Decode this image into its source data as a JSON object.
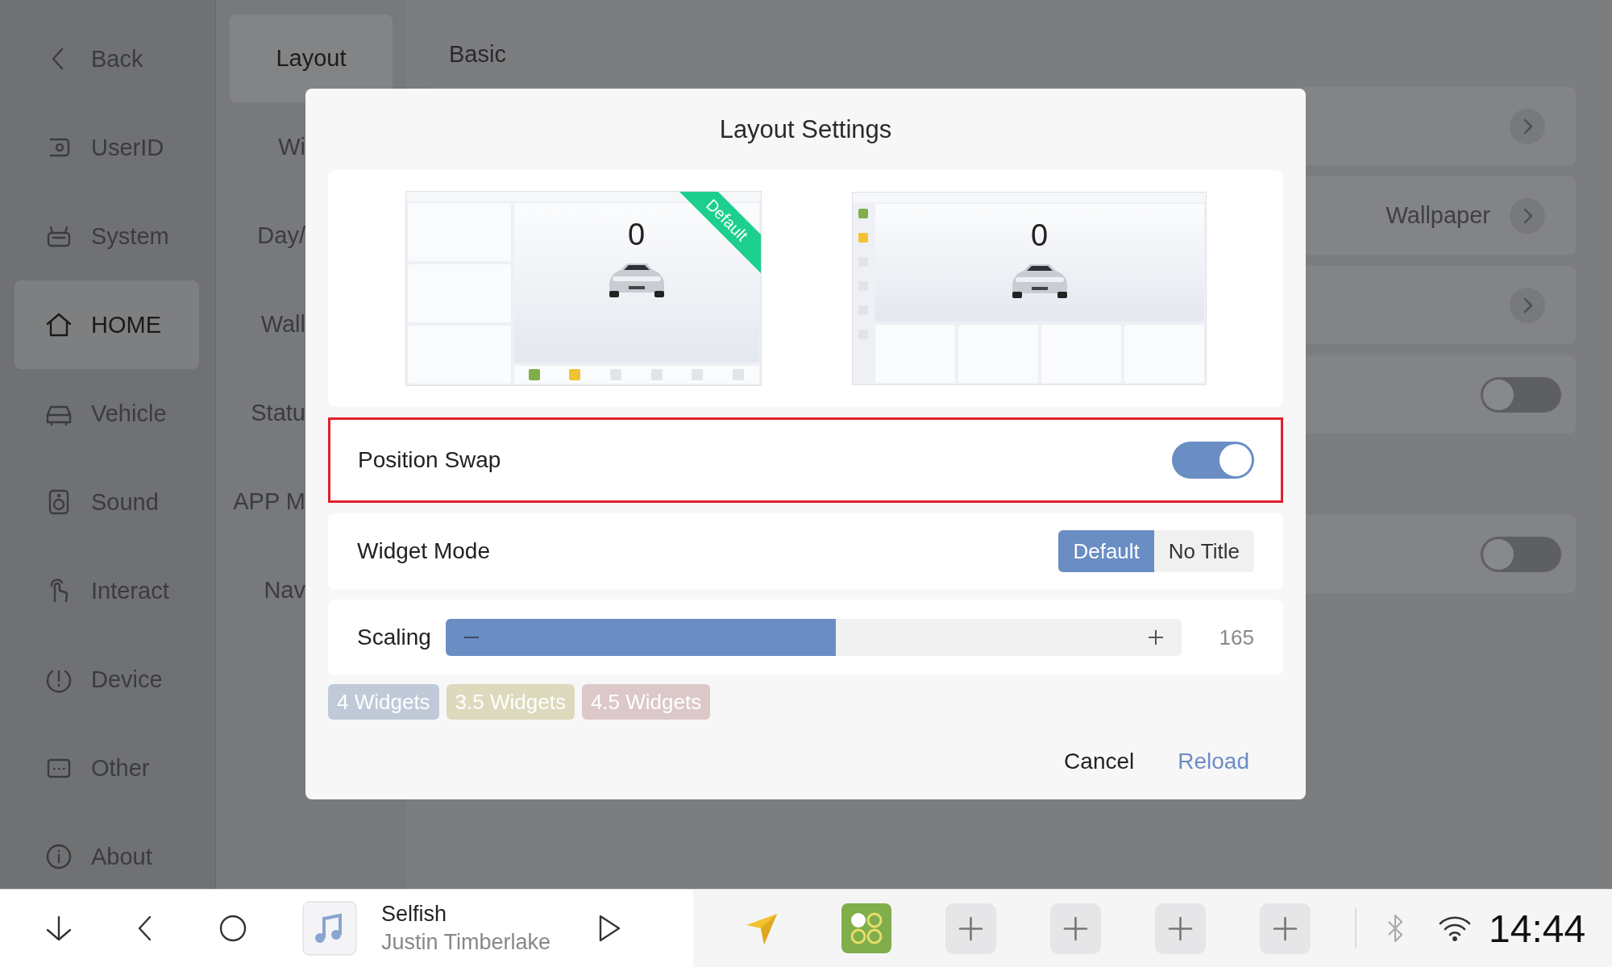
{
  "sidebar": {
    "items": [
      {
        "label": "Back",
        "selected": false
      },
      {
        "label": "UserID",
        "selected": false
      },
      {
        "label": "System",
        "selected": false
      },
      {
        "label": "HOME",
        "selected": true
      },
      {
        "label": "Vehicle",
        "selected": false
      },
      {
        "label": "Sound",
        "selected": false
      },
      {
        "label": "Interact",
        "selected": false
      },
      {
        "label": "Device",
        "selected": false
      },
      {
        "label": "Other",
        "selected": false
      },
      {
        "label": "About",
        "selected": false
      }
    ]
  },
  "subnav": {
    "items": [
      {
        "label": "Layout",
        "selected": true
      },
      {
        "label": "Wi",
        "selected": false
      },
      {
        "label": "Day/",
        "selected": false
      },
      {
        "label": "Wall",
        "selected": false
      },
      {
        "label": "Statu",
        "selected": false
      },
      {
        "label": "APP M",
        "selected": false
      },
      {
        "label": "Nav",
        "selected": false
      }
    ]
  },
  "section_title": "Basic",
  "settings_groups": [
    [
      {
        "kind": "chevron"
      },
      {
        "kind": "chevron",
        "label": "Wallpaper"
      },
      {
        "kind": "chevron"
      },
      {
        "kind": "toggle",
        "on": false
      }
    ],
    [
      {
        "kind": "toggle",
        "on": false
      }
    ]
  ],
  "dialog": {
    "title": "Layout Settings",
    "previews": [
      {
        "kind": "side",
        "speed": "0",
        "badge": "Default"
      },
      {
        "kind": "bottom",
        "speed": "0"
      }
    ],
    "position_swap": {
      "label": "Position Swap",
      "on": true,
      "highlighted": true
    },
    "widget_mode": {
      "label": "Widget Mode",
      "options": [
        {
          "label": "Default",
          "selected": true
        },
        {
          "label": "No Title",
          "selected": false
        }
      ]
    },
    "scaling": {
      "label": "Scaling",
      "level": 0.53,
      "value": "165"
    },
    "presets": [
      {
        "label": "4 Widgets",
        "color": "#bfc9d8"
      },
      {
        "label": "3.5 Widgets",
        "color": "#ddd9bd"
      },
      {
        "label": "4.5 Widgets",
        "color": "#dcc8c9"
      }
    ],
    "buttons": [
      {
        "label": "Cancel",
        "kind": "plain"
      },
      {
        "label": "Reload",
        "kind": "primary"
      }
    ]
  },
  "media": {
    "title": "Selfish",
    "artist": "Justin Timberlake"
  },
  "clock": "14:44"
}
